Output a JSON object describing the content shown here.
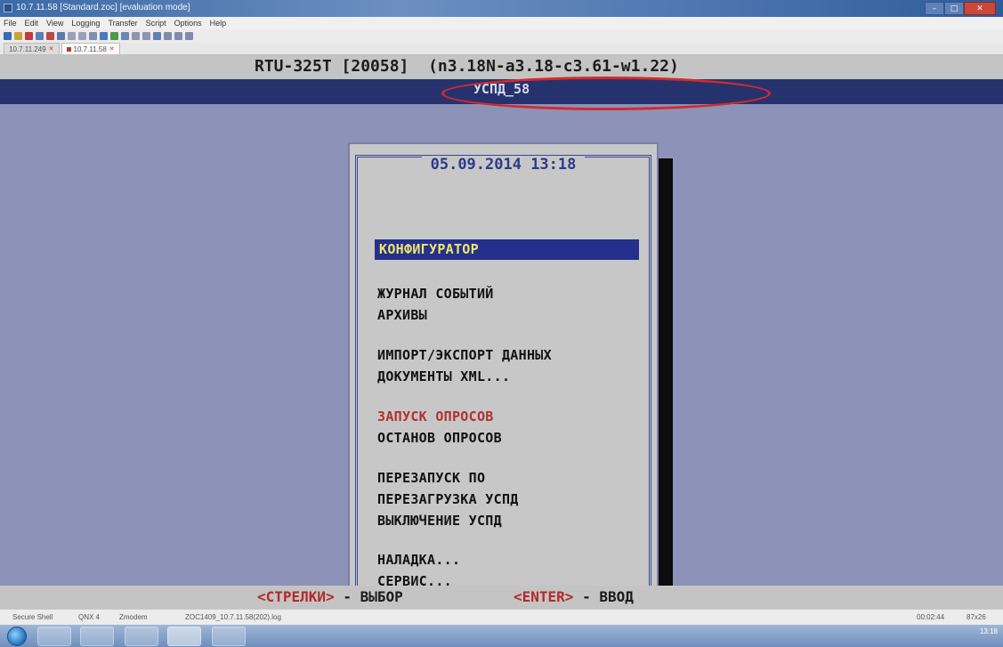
{
  "window": {
    "title": "10.7.11.58 [Standard.zoc] [evaluation mode]",
    "close_icon": "close-icon",
    "minimize_icon": "minimize-icon",
    "maximize_icon": "maximize-icon"
  },
  "menubar": [
    "File",
    "Edit",
    "View",
    "Logging",
    "Transfer",
    "Script",
    "Options",
    "Help"
  ],
  "tabs": [
    {
      "label": "10.7.11.249"
    },
    {
      "label": "10.7.11.58"
    }
  ],
  "terminal": {
    "header_line": "RTU-325T [20058]  (n3.18N-a3.18-c3.61-w1.22)",
    "uspd_name": "УСПД_58",
    "menu": {
      "date": "05.09.2014 13:18",
      "items": [
        {
          "label": "КОНФИГУРАТОР"
        },
        {
          "label": "ЖУРНАЛ СОБЫТИЙ"
        },
        {
          "label": "АРХИВЫ"
        },
        {
          "label": "ИМПОРТ/ЭКСПОРТ ДАННЫХ"
        },
        {
          "label": "ДОКУМЕНТЫ XML..."
        },
        {
          "label": "ЗАПУСК ОПРОСОВ"
        },
        {
          "label": "ОСТАНОВ ОПРОСОВ"
        },
        {
          "label": "ПЕРЕЗАПУСК ПО"
        },
        {
          "label": "ПЕРЕЗАГРУЗКА УСПД"
        },
        {
          "label": "ВЫКЛЮЧЕНИЕ УСПД"
        },
        {
          "label": "НАЛАДКА..."
        },
        {
          "label": "СЕРВИС..."
        }
      ]
    },
    "hints": {
      "arrows_key": "<СТРЕЛКИ>",
      "arrows_action": " - ВЫБОР",
      "enter_key": "<ENTER>",
      "enter_action": " - ВВОД"
    }
  },
  "statusbar": {
    "connection": "Secure Shell",
    "emulation": "QNX 4",
    "transfer": "Zmodem",
    "logfile": "ZOC1409_10.7.11.58(202).log",
    "time": "00:02:44",
    "size": "87x26"
  },
  "taskbar": {
    "clock": "13:18"
  },
  "colors": {
    "terminal_bg": "#8d93b8",
    "header_bar": "#26326e",
    "selection": "#24308c",
    "selected_text": "#f0e66a",
    "accent_red": "#b23030",
    "annotation": "#d42a2a"
  }
}
